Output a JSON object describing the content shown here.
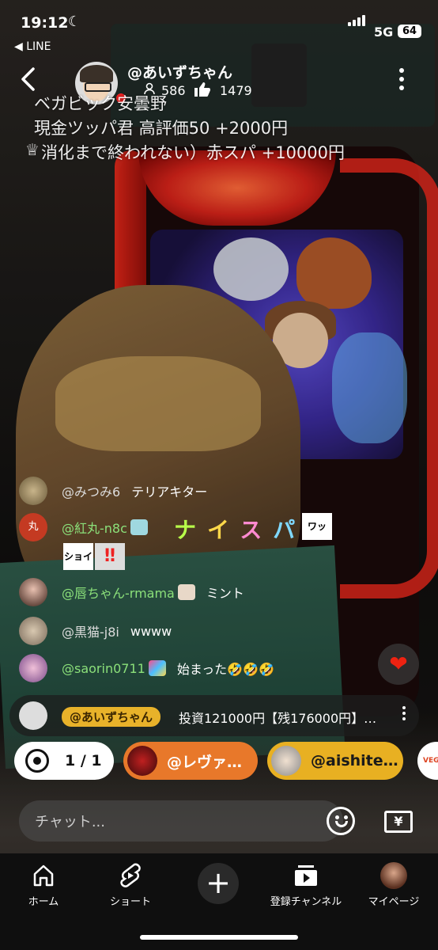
{
  "status_bar": {
    "time": "19:12",
    "back_app": "◀ LINE",
    "network": "5G",
    "battery": "64"
  },
  "header": {
    "channel_name": "@あいずちゃん",
    "viewers": "586",
    "likes": "1479"
  },
  "stream_title": [
    "ベガビック安曇野",
    "現金ツッパ君                          高評価50 +2000円",
    "消化まで終われない）赤スパ +10000円"
  ],
  "chat": [
    {
      "user": "@みつみ6",
      "message": "テリアキター",
      "user_color": "#dcdcdc"
    },
    {
      "user": "@紅丸-n8c",
      "message": "",
      "avatar_text": "丸",
      "user_color": "#8be07a"
    },
    {
      "user": "@唇ちゃん-rmama",
      "message": "ミント",
      "user_color": "#8be07a"
    },
    {
      "user": "@黒猫-j8i",
      "message": "wwww",
      "user_color": "#dcdcdc"
    },
    {
      "user": "@saorin0711",
      "message": "始まった🤣🤣🤣",
      "user_color": "#8be07a"
    }
  ],
  "nice_text": [
    "ナ",
    "イ",
    "ス",
    "パ"
  ],
  "stamps": {
    "wow": "ワッ",
    "shoi": "ショイ",
    "bang": "‼"
  },
  "pinned": {
    "user": "@あいずちゃん",
    "message": "投資121000円【残176000円】…"
  },
  "goal": {
    "count": "1 / 1"
  },
  "supporters": [
    {
      "label": "@レヴァ…"
    },
    {
      "label": "@aishite…"
    }
  ],
  "promo_label": "VEGAS",
  "chat_input": {
    "placeholder": "チャット..."
  },
  "yen_label": "¥",
  "nav": [
    {
      "label": "ホーム",
      "icon": "home-icon"
    },
    {
      "label": "ショート",
      "icon": "shorts-icon"
    },
    {
      "label": "",
      "icon": "create-icon"
    },
    {
      "label": "登録チャンネル",
      "icon": "subscriptions-icon"
    },
    {
      "label": "マイページ",
      "icon": "avatar-icon"
    }
  ],
  "colors": {
    "live_red": "#e22222",
    "pin_tag": "#e8b22a",
    "pill_orange": "#e8782a",
    "pill_yellow": "#e8b022"
  }
}
